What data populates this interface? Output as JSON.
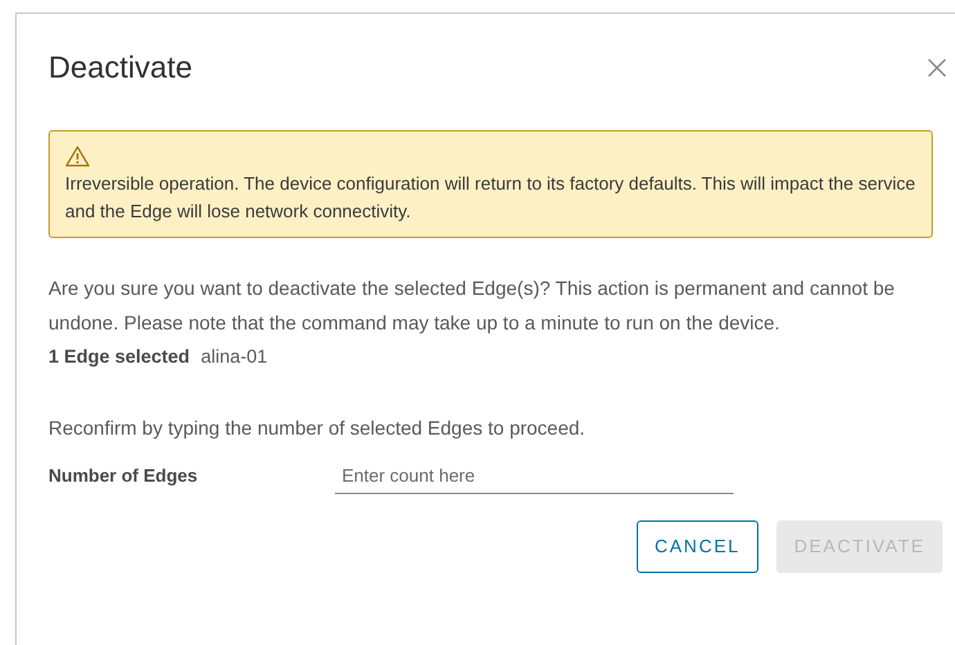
{
  "dialog": {
    "title": "Deactivate"
  },
  "alert": {
    "message": "Irreversible operation. The device configuration will return to its factory defaults. This will impact the service and the Edge will lose network connectivity."
  },
  "body": "Are you sure you want to deactivate the selected Edge(s)? This action is permanent and cannot be undone. Please note that the command may take up to a minute to run on the device.",
  "selection": {
    "label": "1 Edge selected",
    "value": "alina-01"
  },
  "reconfirm": "Reconfirm by typing the number of selected Edges to proceed.",
  "field": {
    "label": "Number of Edges",
    "placeholder": "Enter count here"
  },
  "buttons": [
    {
      "label": "CANCEL",
      "kind": "outline",
      "disabled": false
    },
    {
      "label": "DEACTIVATE",
      "kind": "primary",
      "disabled": true
    }
  ]
}
